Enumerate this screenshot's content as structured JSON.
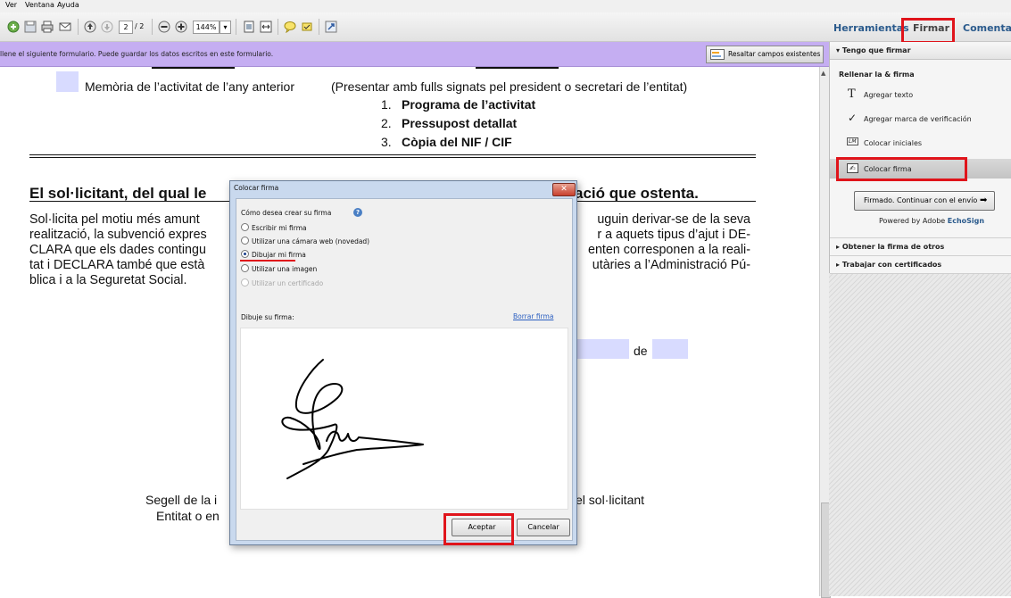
{
  "menu": {
    "items": [
      "Ver",
      "Ventana",
      "Ayuda"
    ]
  },
  "toolbar": {
    "page_current": "2",
    "page_total": "/ 2",
    "zoom": "144%"
  },
  "tabs": {
    "tools": "Herramientas",
    "sign": "Firmar",
    "comment": "Comentario"
  },
  "form_bar": {
    "message": "llene el siguiente formulario. Puede guardar los datos escritos en este formulario.",
    "highlight_button": "Resaltar campos existentes"
  },
  "document": {
    "memoria_line": "Memòria de l’activitat de l’any anterior",
    "presentar_line": "(Presentar amb fulls signats pel president o secretari de l’entitat)",
    "list": [
      {
        "num": "1.",
        "text": "Programa de l’activitat"
      },
      {
        "num": "2.",
        "text": "Pressupost detallat"
      },
      {
        "num": "3.",
        "text": "Còpia del NIF / CIF"
      }
    ],
    "heading_left": "El sol·licitant, del qual le",
    "heading_right": "ació que ostenta.",
    "para_left": [
      "Sol·licita pel motiu més amunt",
      "realització, la subvenció expres",
      "CLARA que els dades contingu",
      "tat i DECLARA també que està",
      "blica i a la Seguretat Social."
    ],
    "para_right": [
      "uguin derivar-se de la seva",
      "r a aquets tipus d’ajut i DE-",
      "enten corresponen a la reali-",
      "utàries a l’Administració Pú-"
    ],
    "de_label": "de",
    "segell_left_1": "Segell de la i",
    "segell_left_2": "Entitat o en",
    "segell_right": "el sol·licitant"
  },
  "panel": {
    "section_tengo": "Tengo que firmar",
    "subsection": "Rellenar la & firma",
    "items": [
      {
        "icon": "T",
        "label": "Agregar texto"
      },
      {
        "icon": "✓",
        "label": "Agregar marca de verificación"
      },
      {
        "icon": "LM",
        "label": "Colocar iniciales"
      },
      {
        "icon": "✍",
        "label": "Colocar firma"
      }
    ],
    "send_button": "Firmado. Continuar con el envío",
    "powered_by": "Powered by Adobe",
    "powered_brand": "EchoSign",
    "section_obtener": "Obtener la firma de otros",
    "section_certificados": "Trabajar con certificados"
  },
  "dialog": {
    "title": "Colocar firma",
    "question": "Cómo desea crear su firma",
    "options": [
      {
        "label": "Escribir mi firma",
        "selected": false,
        "disabled": false
      },
      {
        "label": "Utilizar una cámara web (novedad)",
        "selected": false,
        "disabled": false
      },
      {
        "label": "Dibujar mi firma",
        "selected": true,
        "disabled": false
      },
      {
        "label": "Utilizar una imagen",
        "selected": false,
        "disabled": false
      },
      {
        "label": "Utilizar un certificado",
        "selected": false,
        "disabled": true
      }
    ],
    "draw_label": "Dibuje su firma:",
    "clear_link": "Borrar firma",
    "accept": "Aceptar",
    "cancel": "Cancelar"
  },
  "colors": {
    "highlight_red": "#e0141b",
    "form_bar": "#c5aef2",
    "field": "#d8dbff",
    "tab_link": "#2a5a8c"
  }
}
